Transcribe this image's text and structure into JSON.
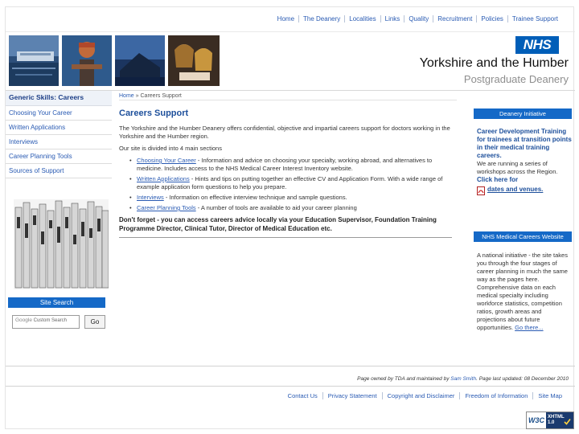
{
  "top_nav": [
    "Home",
    "The Deanery",
    "Localities",
    "Links",
    "Quality",
    "Recruitment",
    "Policies",
    "Trainee Support"
  ],
  "header": {
    "logo_text": "NHS",
    "brand_main": "Yorkshire and the Humber",
    "brand_sub": "Postgraduate Deanery"
  },
  "sidebar": {
    "title": "Generic Skills: Careers",
    "items": [
      "Choosing Your Career",
      "Written Applications",
      "Interviews",
      "Career Planning Tools",
      "Sources of Support"
    ],
    "search_title": "Site Search",
    "search_placeholder": "Custom Search",
    "search_brand": "Google",
    "go_label": "Go"
  },
  "main": {
    "breadcrumb_home": "Home",
    "breadcrumb_sep": "»",
    "breadcrumb_current": "Careers Support",
    "title": "Careers Support",
    "intro": "The Yorkshire and the Humber Deanery offers confidential, objective and impartial careers support for doctors working in the Yorkshire and the Humber region.",
    "intro2": "Our site is divided into 4 main sections",
    "sections": [
      {
        "link": "Choosing Your Career",
        "text": " - Information and advice on choosing your specialty, working abroad, and alternatives to medicine. Includes access to the NHS Medical Career Interest Inventory website."
      },
      {
        "link": "Written Applications",
        "text": " - Hints and tips on putting together an effective CV and Application Form. With a wide range of example application form questions to help you prepare."
      },
      {
        "link": "Interviews",
        "text": " - Information on effective interview technique and sample questions."
      },
      {
        "link": "Career Planning Tools",
        "text": " - A number of tools are available to aid your career planning"
      }
    ],
    "dont_forget": "Don't forget - you can access careers advice locally via your Education Supervisor, Foundation Training Programme Director, Clinical Tutor, Director of Medical Education etc."
  },
  "right": {
    "deanery_header": "Deanery Initiative",
    "deanery_title": "Career Development Training for trainees at transition points in their medical training careers.",
    "deanery_body": "We are running a series of workshops across the Region.",
    "deanery_click": "Click here for",
    "deanery_dates": "dates and venues.",
    "mc_header": "NHS Medical Careers Website",
    "mc_body": "A national initiative - the site takes you through the four stages of career planning in much the same way as the pages here. Comprehensive data on each medical specialty including workforce statistics, competition ratios, growth areas and projections about future opportunities.",
    "mc_link": "Go there..."
  },
  "footer": {
    "meta_prefix": "Page owned by TDA and maintained by",
    "meta_owner": "Sam Smith",
    "meta_updated": ". Page last updated: 08 December 2010",
    "nav": [
      "Contact Us",
      "Privacy Statement",
      "Copyright and Disclaimer",
      "Freedom of Information",
      "Site Map"
    ],
    "badge_w3c": "W3C",
    "badge_xhtml": "XHTML",
    "badge_version": "1.0"
  },
  "icons": {
    "pdf": "pdf-icon",
    "check": "check-icon"
  },
  "colors": {
    "nhs_blue": "#005eb8",
    "panel_blue": "#1569c7",
    "link_blue": "#2a5bb3",
    "title_blue": "#1d4f9b"
  }
}
